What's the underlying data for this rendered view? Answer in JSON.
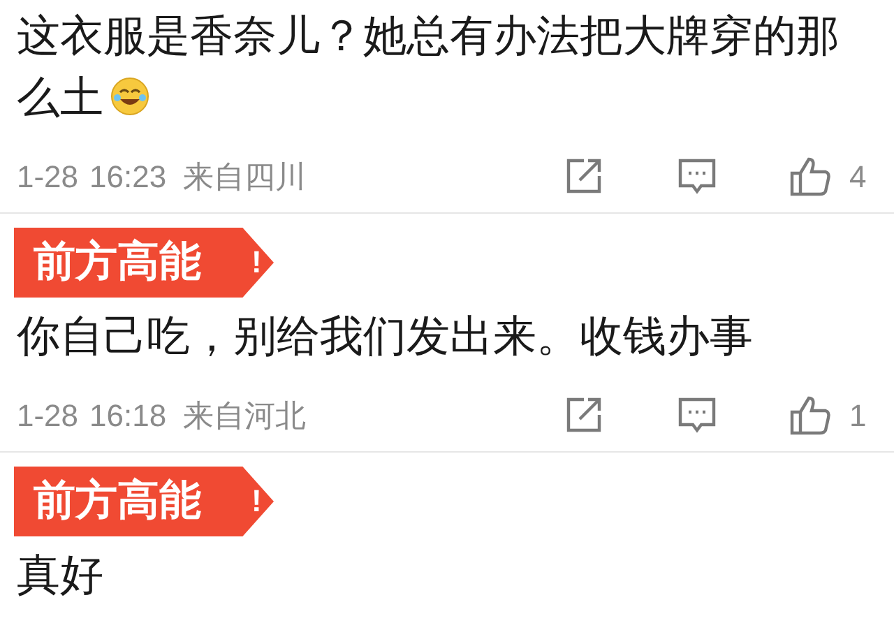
{
  "comments": [
    {
      "text": "这衣服是香奈儿？她总有办法把大牌穿的那么土",
      "emoji": true,
      "date": "1-28",
      "time": "16:23",
      "location": "来自四川",
      "likes": "4"
    },
    {
      "badge": "前方高能",
      "badge_mark": "!",
      "text": "你自己吃，别给我们发出来。收钱办事",
      "emoji": false,
      "date": "1-28",
      "time": "16:18",
      "location": "来自河北",
      "likes": "1"
    },
    {
      "badge": "前方高能",
      "badge_mark": "!",
      "text": "真好",
      "emoji": false
    }
  ]
}
